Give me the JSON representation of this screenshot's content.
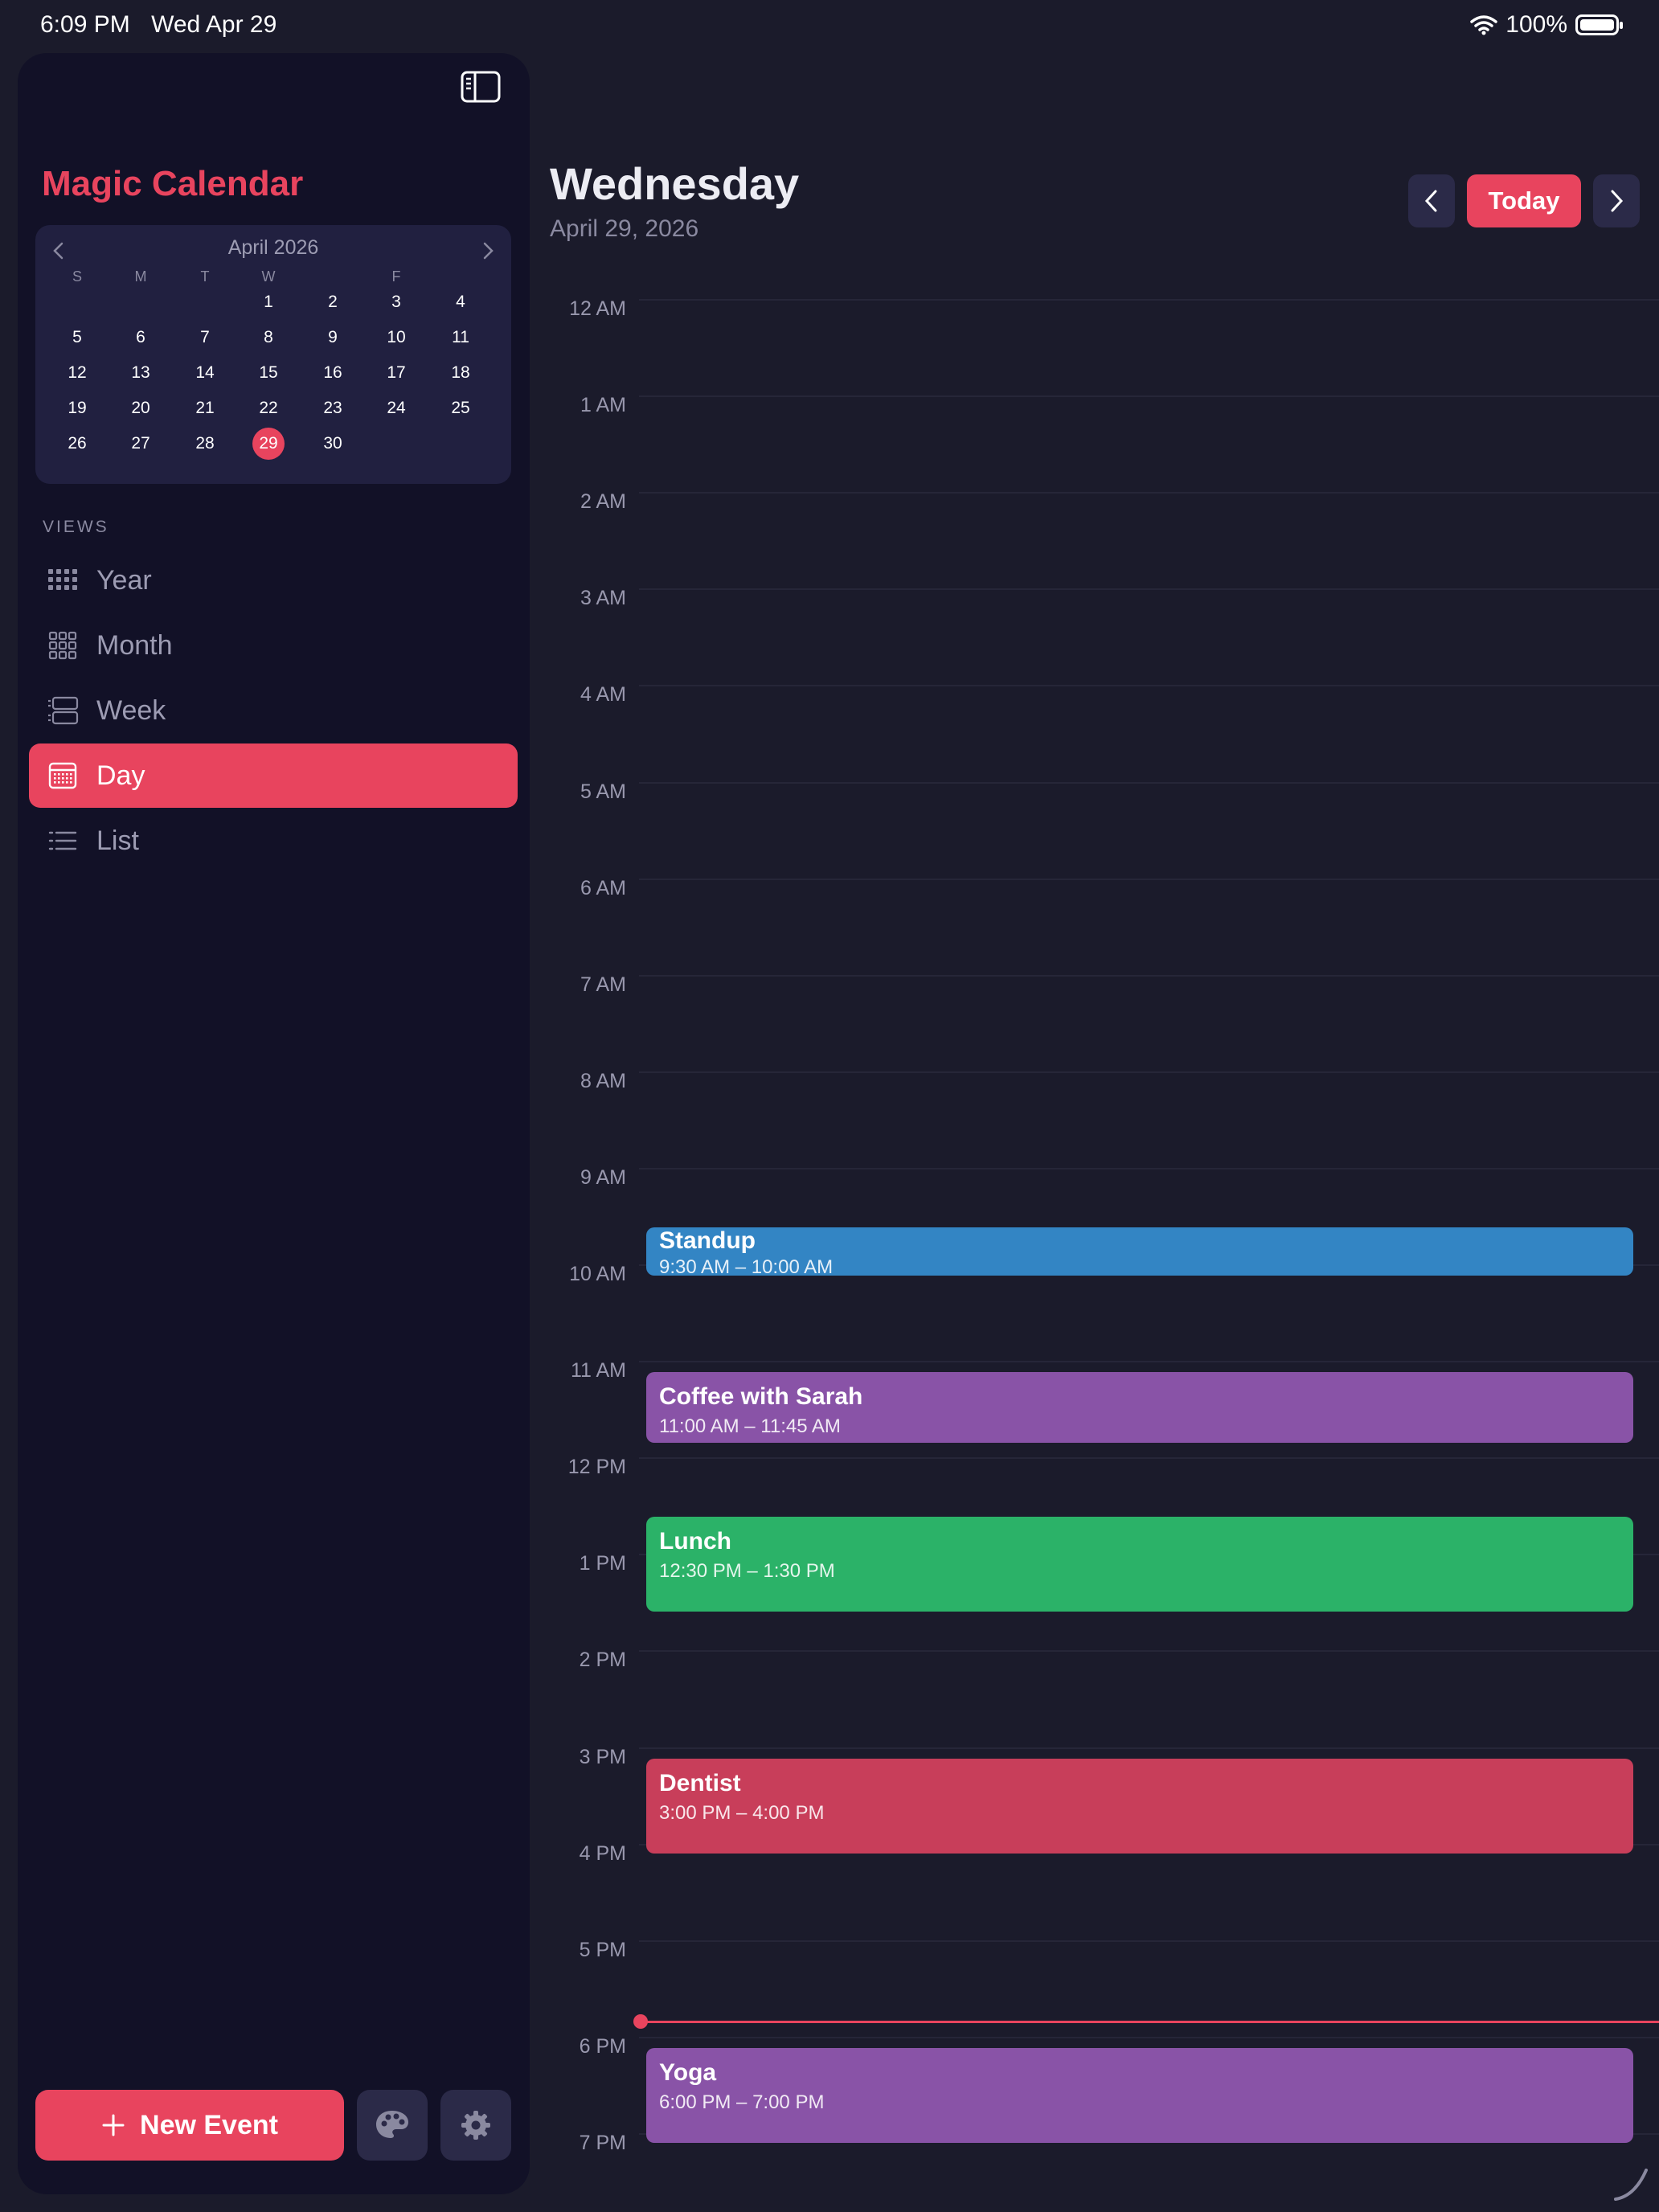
{
  "status_bar": {
    "time": "6:09 PM",
    "date": "Wed Apr 29",
    "battery": "100%"
  },
  "sidebar": {
    "app_title": "Magic Calendar",
    "mini_calendar": {
      "month_label": "April 2026",
      "weekdays": [
        "S",
        "M",
        "T",
        "W",
        "",
        "F",
        ""
      ],
      "weeks": [
        [
          "",
          "",
          "",
          "1",
          "2",
          "3",
          "4"
        ],
        [
          "5",
          "6",
          "7",
          "8",
          "9",
          "10",
          "11"
        ],
        [
          "12",
          "13",
          "14",
          "15",
          "16",
          "17",
          "18"
        ],
        [
          "19",
          "20",
          "21",
          "22",
          "23",
          "24",
          "25"
        ],
        [
          "26",
          "27",
          "28",
          "29",
          "30",
          "",
          ""
        ]
      ],
      "selected_day": "29"
    },
    "views_label": "VIEWS",
    "views": [
      {
        "label": "Year",
        "icon": "year-grid-icon",
        "active": false
      },
      {
        "label": "Month",
        "icon": "month-grid-icon",
        "active": false
      },
      {
        "label": "Week",
        "icon": "week-rows-icon",
        "active": false
      },
      {
        "label": "Day",
        "icon": "day-calendar-icon",
        "active": true
      },
      {
        "label": "List",
        "icon": "list-icon",
        "active": false
      }
    ],
    "new_event_label": "New Event"
  },
  "header": {
    "day_name": "Wednesday",
    "full_date": "April 29, 2026",
    "today_label": "Today"
  },
  "timeline": {
    "hours": [
      "12 AM",
      "1 AM",
      "2 AM",
      "3 AM",
      "4 AM",
      "5 AM",
      "6 AM",
      "7 AM",
      "8 AM",
      "9 AM",
      "10 AM",
      "11 AM",
      "12 PM",
      "1 PM",
      "2 PM",
      "3 PM",
      "4 PM",
      "5 PM",
      "6 PM",
      "7 PM"
    ],
    "current_time": "6:09 PM",
    "events": [
      {
        "title": "Standup",
        "time": "9:30 AM – 10:00 AM",
        "color": "#3385c4"
      },
      {
        "title": "Coffee with Sarah",
        "time": "11:00 AM – 11:45 AM",
        "color": "#8953a7"
      },
      {
        "title": "Lunch",
        "time": "12:30 PM – 1:30 PM",
        "color": "#2bb268"
      },
      {
        "title": "Dentist",
        "time": "3:00 PM – 4:00 PM",
        "color": "#c83e5a"
      },
      {
        "title": "Yoga",
        "time": "6:00 PM – 7:00 PM",
        "color": "#8953a7"
      }
    ]
  },
  "colors": {
    "accent": "#e8445e",
    "background": "#1b1b2b",
    "sidebar": "#121127"
  }
}
